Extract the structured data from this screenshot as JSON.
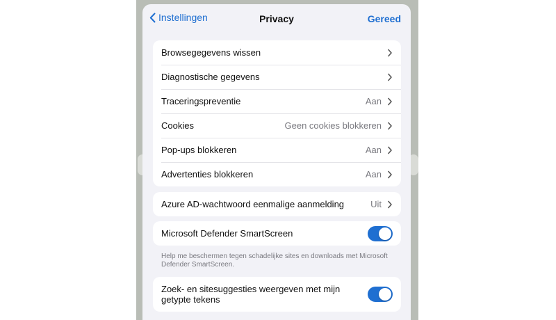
{
  "navbar": {
    "back_label": "Instellingen",
    "title": "Privacy",
    "done_label": "Gereed"
  },
  "group1": [
    {
      "label": "Browsegegevens wissen",
      "value": ""
    },
    {
      "label": "Diagnostische gegevens",
      "value": ""
    },
    {
      "label": "Traceringspreventie",
      "value": "Aan"
    },
    {
      "label": "Cookies",
      "value": "Geen cookies blokkeren"
    },
    {
      "label": "Pop-ups blokkeren",
      "value": "Aan"
    },
    {
      "label": "Advertenties blokkeren",
      "value": "Aan"
    }
  ],
  "group2": {
    "label": "Azure AD-wachtwoord eenmalige aanmelding",
    "value": "Uit"
  },
  "smartscreen": {
    "label": "Microsoft Defender SmartScreen",
    "enabled": true,
    "footnote": "Help me beschermen tegen schadelijke sites en downloads met Microsoft Defender SmartScreen."
  },
  "suggestions": {
    "label": "Zoek- en sitesuggesties weergeven met mijn getypte tekens",
    "enabled": true
  },
  "colors": {
    "accent": "#1f6fd1",
    "background": "#f2f2f7",
    "secondary_text": "#7a7a80"
  }
}
